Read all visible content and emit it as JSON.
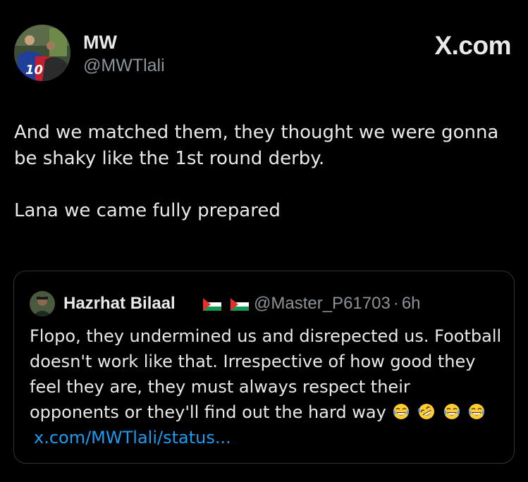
{
  "post": {
    "display_name": "MW",
    "handle": "@MWTlali",
    "brand": "X.com",
    "avatar_jersey_number": "10",
    "text_line1": "And we matched them, they thought we were gonna be shaky like the 1st round derby.",
    "text_line2": "Lana we came fully prepared"
  },
  "quote": {
    "display_name": "Hazrhat Bilaal",
    "flag_icons": [
      "palestine-flag-icon",
      "palestine-flag-icon"
    ],
    "handle": "@Master_P61703",
    "separator": "·",
    "time": "6h",
    "text": "Flopo, they  undermined us and disrepected us. Football doesn't work like that. Irrespective of how good they feel they are, they must always respect their opponents or they'll  find out the hard way",
    "emoji_icons": [
      "face-with-tears-of-joy-icon",
      "rolling-on-floor-laughing-icon",
      "face-with-tears-of-joy-icon",
      "face-with-tears-of-joy-icon"
    ],
    "link": "x.com/MWTlali/status..."
  },
  "colors": {
    "background": "#000000",
    "text": "#e7e9ea",
    "secondary": "#8b9399",
    "link": "#1d9bf0",
    "border": "#2f3336"
  }
}
